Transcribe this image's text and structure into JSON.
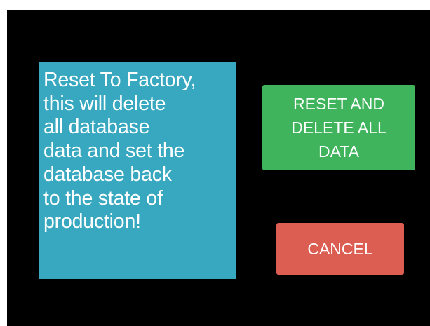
{
  "dialog": {
    "message": "Reset To Factory,\nthis will delete\nall database\ndata and set the\ndatabase back\nto the state of\nproduction!",
    "confirm_label": "RESET AND\nDELETE ALL\nDATA",
    "cancel_label": "CANCEL"
  },
  "colors": {
    "background": "#000000",
    "message_panel": "#37a8bf",
    "confirm_button": "#3fb45c",
    "cancel_button": "#dc5d52",
    "text": "#ffffff"
  }
}
